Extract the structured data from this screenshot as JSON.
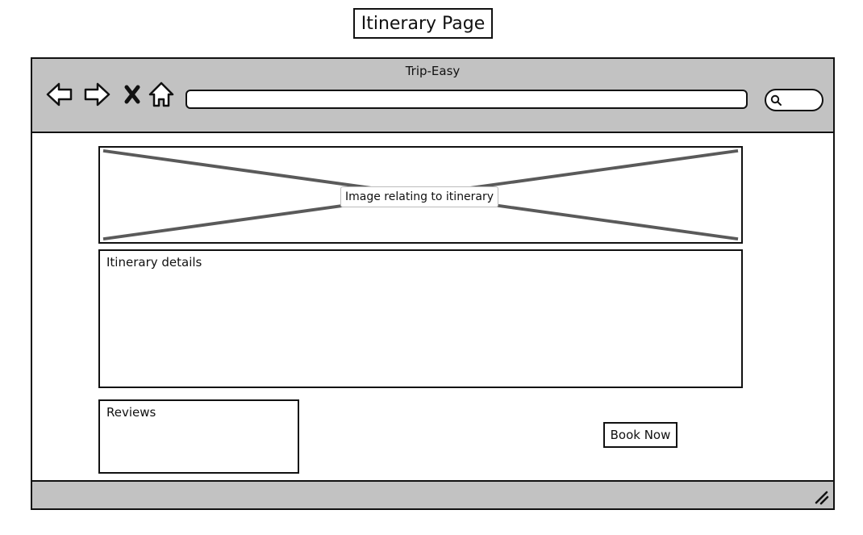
{
  "page": {
    "title": "Itinerary Page"
  },
  "browser": {
    "window_title": "Trip-Easy",
    "address_bar": {
      "value": "",
      "placeholder": ""
    },
    "search": {
      "value": ""
    },
    "nav_icons": [
      "back-arrow-icon",
      "forward-arrow-icon",
      "close-icon",
      "home-icon"
    ]
  },
  "content": {
    "image_caption": "Image relating to itinerary",
    "details_label": "Itinerary details",
    "reviews_label": "Reviews",
    "book_button": "Book Now"
  },
  "colors": {
    "chrome": "#c2c2c2",
    "outline": "#111111",
    "placeholder_x": "#5a5a5a"
  }
}
